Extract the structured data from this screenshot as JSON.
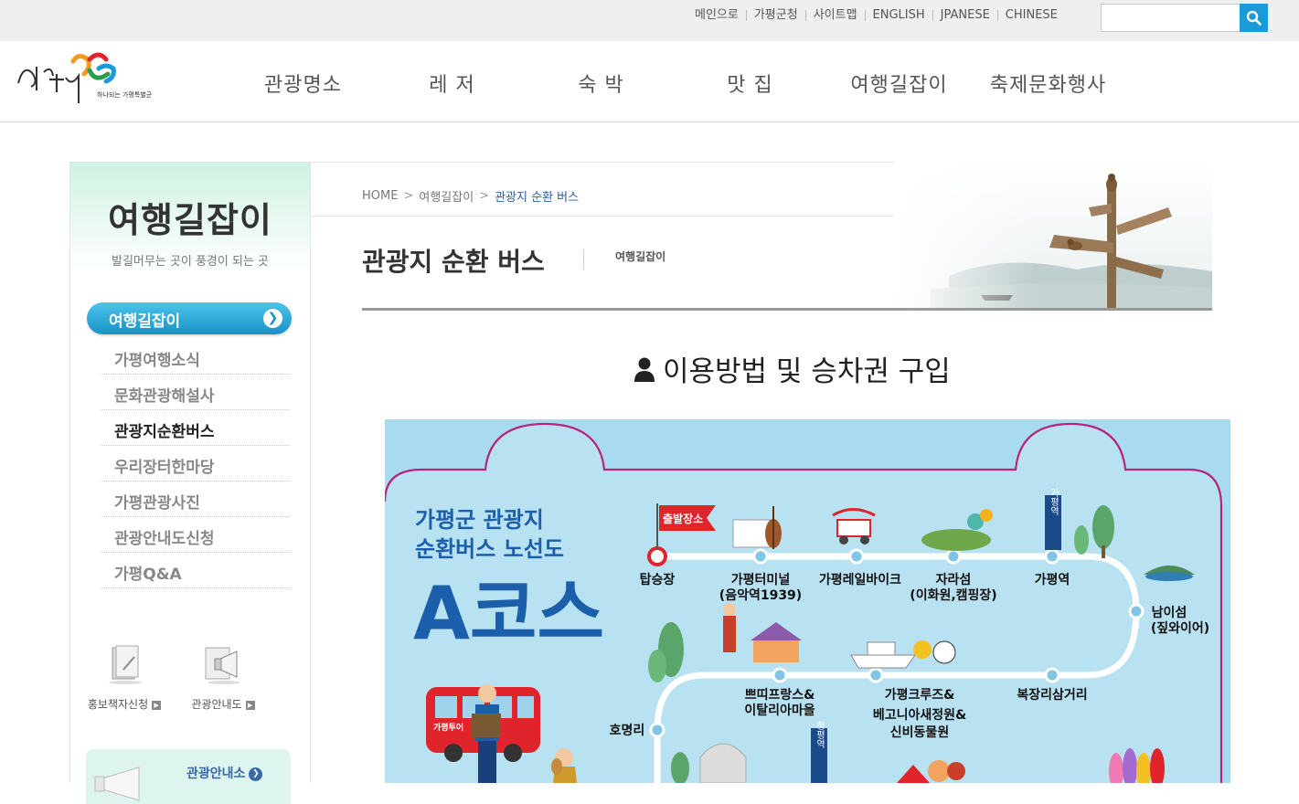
{
  "utility": {
    "links": [
      "메인으로",
      "가평군청",
      "사이트맵",
      "ENGLISH",
      "JPANESE",
      "CHINESE"
    ],
    "search_placeholder": "",
    "search_icon": "search-icon"
  },
  "header": {
    "logo_text": "하나되는 가평특별군",
    "nav": [
      "관광명소",
      "레 저",
      "숙 박",
      "맛 집",
      "여행길잡이",
      "축제문화행사"
    ]
  },
  "sidebar": {
    "title": "여행길잡이",
    "subtitle": "발길머무는 곳이 풍경이 되는 곳",
    "active_label": "여행길잡이",
    "items": [
      {
        "label": "가평여행소식"
      },
      {
        "label": "문화관광해설사"
      },
      {
        "label": "관광지순환버스"
      },
      {
        "label": "우리장터한마당"
      },
      {
        "label": "가평관광사진"
      },
      {
        "label": "관광안내도신청"
      },
      {
        "label": "가평Q&A"
      }
    ],
    "current_index": 2,
    "quick_links": [
      "홍보책자신청",
      "관광안내도"
    ],
    "tour_box_label": "관광안내소"
  },
  "content": {
    "breadcrumb": [
      "HOME",
      "여행길잡이",
      "관광지 순환 버스"
    ],
    "page_title": "관광지 순환 버스",
    "category": "여행길잡이",
    "section_title": "이용방법 및 승차권 구입"
  },
  "map": {
    "heading_line1": "가평군 관광지",
    "heading_line2": "순환버스 노선도",
    "course": "A코스",
    "start_flag": "출발장소",
    "bus_label": "가평투어",
    "stops": [
      {
        "name": "탑승장",
        "sub": ""
      },
      {
        "name": "가평터미널",
        "sub": "(음악역1939)"
      },
      {
        "name": "가평레일바이크",
        "sub": ""
      },
      {
        "name": "자라섬",
        "sub": "(이화원,캠핑장)"
      },
      {
        "name": "가평역",
        "sub": ""
      },
      {
        "name": "남이섬",
        "sub": "(짚와이어)"
      },
      {
        "name": "복장리삼거리",
        "sub": ""
      },
      {
        "name": "가평크루즈&",
        "sub": "베고니아새정원&",
        "sub2": "신비동물원"
      },
      {
        "name": "쁘띠프랑스&",
        "sub": "이탈리아마을"
      },
      {
        "name": "호명리",
        "sub": ""
      }
    ],
    "station_sign_1": "가평역",
    "station_sign_2": "청평역"
  },
  "colors": {
    "accent_blue": "#1a9ad6",
    "map_bg": "#a9dbf0",
    "map_title": "#1b5fab",
    "route_line": "#ffffff",
    "start_red": "#e0242c"
  }
}
